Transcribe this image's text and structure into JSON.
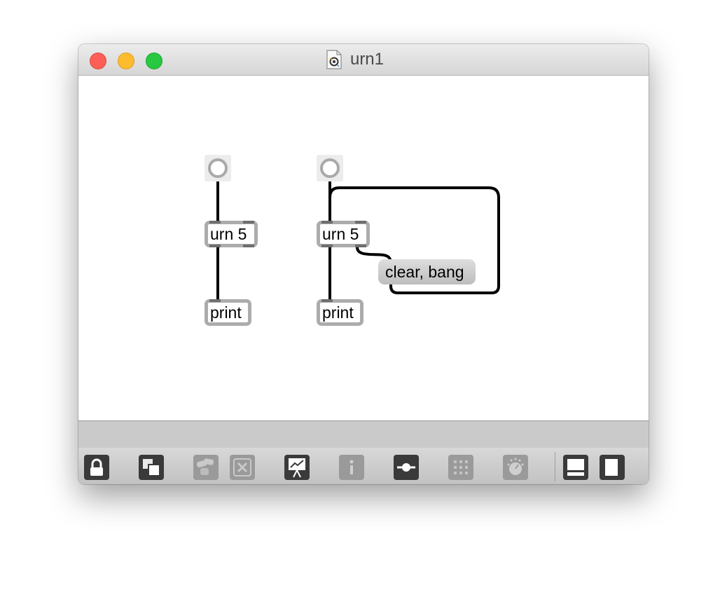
{
  "window": {
    "title": "urn1",
    "traffic_colors": {
      "close": "#fd5f57",
      "minimize": "#fdbc2e",
      "zoom": "#28c840"
    }
  },
  "patch": {
    "left_group": {
      "object_label": "urn 5",
      "print_label": "print"
    },
    "right_group": {
      "object_label": "urn 5",
      "print_label": "print",
      "message_label": "clear, bang"
    }
  },
  "toolbar": {
    "buttons": [
      {
        "name": "lock",
        "icon": "lock-icon",
        "enabled": true
      },
      {
        "name": "presentation-mode",
        "icon": "overlap-squares-icon",
        "enabled": true
      },
      {
        "name": "objects",
        "icon": "object-palette-icon",
        "enabled": false
      },
      {
        "name": "clear",
        "icon": "x-icon",
        "enabled": false
      },
      {
        "name": "presentation",
        "icon": "easel-icon",
        "enabled": true
      },
      {
        "name": "inspector",
        "icon": "info-icon",
        "enabled": false
      },
      {
        "name": "slider",
        "icon": "slider-icon",
        "enabled": true
      },
      {
        "name": "grid",
        "icon": "grid-icon",
        "enabled": false
      },
      {
        "name": "dial",
        "icon": "dial-icon",
        "enabled": false
      },
      {
        "name": "bottom-panel",
        "icon": "bottom-panel-icon",
        "enabled": true
      },
      {
        "name": "side-panel",
        "icon": "side-panel-icon",
        "enabled": true
      }
    ]
  }
}
